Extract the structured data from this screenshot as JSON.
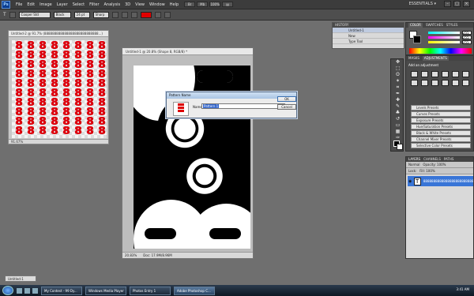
{
  "app": {
    "logo": "Ps",
    "menu": [
      "File",
      "Edit",
      "Image",
      "Layer",
      "Select",
      "Filter",
      "Analysis",
      "3D",
      "View",
      "Window",
      "Help"
    ],
    "menu_tools": [
      "Br",
      "Mb",
      "100%",
      "▤"
    ],
    "workspace": "ESSENTIALS ▾",
    "window_buttons": [
      "–",
      "□",
      "×"
    ]
  },
  "options_bar": {
    "tool_icon": "T",
    "font": "Cooper Std",
    "style": "Black",
    "size": "24 pt",
    "aa": "Sharp",
    "color_hex": "#e00000"
  },
  "doc_small": {
    "title": "Untitled-2 @ 91.7% (888888888888888888888888888...)",
    "glyph": "8",
    "status": "91.67%"
  },
  "doc_main": {
    "title": "Untitled-1 @ 20.8% (Shape 8, RGB/8) *",
    "zoom": "20.83%",
    "doc_size": "Doc: 17.9M/8.96M"
  },
  "dialog": {
    "title": "Pattern Name",
    "name_label": "Name:",
    "name_value": "Pattern 1",
    "ok": "OK",
    "cancel": "Cancel"
  },
  "history": {
    "title": "HISTORY",
    "rows": [
      "Untitled-1",
      "New",
      "Type Tool"
    ]
  },
  "color_panel": {
    "tabs": [
      "COLOR",
      "SWATCHES",
      "STYLES"
    ],
    "values": [
      "255",
      "255",
      "255"
    ]
  },
  "adjustments": {
    "tabs": [
      "MASKS",
      "ADJUSTMENTS"
    ],
    "header": "Add an adjustment",
    "presets": [
      "Levels Presets",
      "Curves Presets",
      "Exposure Presets",
      "Hue/Saturation Presets",
      "Black & White Presets",
      "Channel Mixer Presets",
      "Selective Color Presets"
    ]
  },
  "layers": {
    "tabs": [
      "LAYERS",
      "CHANNELS",
      "PATHS"
    ],
    "blend": "Normal",
    "opacity": "Opacity: 100%",
    "lock": "Lock:",
    "fill": "Fill: 100%",
    "layer_name": "888888888888888888888888888",
    "layer_thumb": "T"
  },
  "minimized_doc": "Untitled-1",
  "taskbar": {
    "items": [
      "My Contest - 99 Dy...",
      "Windows Media Player",
      "Photos Entry 1",
      "Adobe Photoshop C..."
    ],
    "clock": "3:41 AM"
  }
}
